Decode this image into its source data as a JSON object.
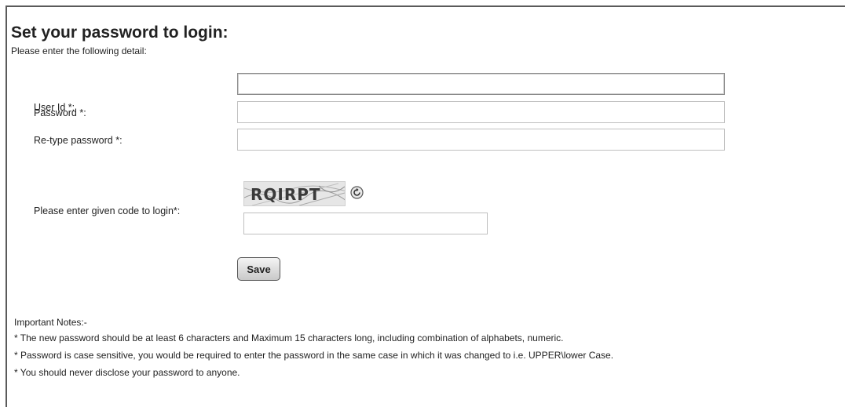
{
  "form": {
    "title": "Set your password to login:",
    "subtitle": "Please enter the following detail:",
    "user_id_label": "User Id *:",
    "user_id_value": "",
    "password_label": "Password *:",
    "password_value": "",
    "retype_label": "Re-type password *:",
    "retype_value": "",
    "captcha_label": "Please enter given code to login*:",
    "captcha_code": "RQIRPT",
    "captcha_value": "",
    "save_label": "Save"
  },
  "notes": {
    "heading": "Important Notes:-",
    "items": [
      "* The new password should be at least 6 characters and Maximum 15 characters long, including combination of alphabets, numeric.",
      "* Password is case sensitive, you would be required to enter the password in the same case in which it was changed to i.e. UPPER\\lower Case.",
      "* You should never disclose your password to anyone."
    ]
  },
  "icons": {
    "refresh": "refresh-icon"
  },
  "colors": {
    "border": "#5a5a5a",
    "field_border": "#bfbfbf",
    "button_top": "#f4f4f4",
    "button_bottom": "#c9c9c9"
  }
}
